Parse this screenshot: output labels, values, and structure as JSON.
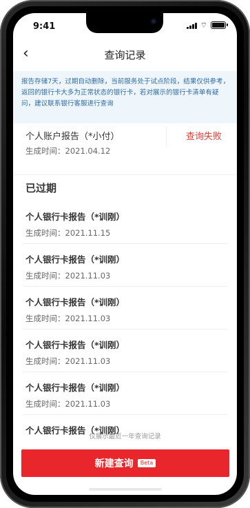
{
  "status_bar": {
    "time": "9:41"
  },
  "navbar": {
    "title": "查询记录",
    "back_icon": "chevron-left-icon"
  },
  "notice": {
    "text": "报告存储7天，过期自动删除，当前服务处于试点阶段，结果仅供参考，返回的银行卡大多为正常状态的银行卡，若对展示的银行卡清单有疑问，建议联系银行客服进行查询"
  },
  "current_record": {
    "title": "个人账户报告（*小付）",
    "time": "生成时间：2021.04.12",
    "status": "查询失败",
    "status_color": "#e53935"
  },
  "expired": {
    "header": "已过期",
    "items": [
      {
        "title": "个人银行卡报告（*训刚）",
        "time": "生成时间：2021.11.15"
      },
      {
        "title": "个人银行卡报告（*训刚）",
        "time": "生成时间：2021.11.03"
      },
      {
        "title": "个人银行卡报告（*训刚）",
        "time": "生成时间：2021.11.03"
      },
      {
        "title": "个人银行卡报告（*训刚）",
        "time": "生成时间：2021.11.03"
      },
      {
        "title": "个人银行卡报告（*训刚）",
        "time": "生成时间：2021.11.03"
      },
      {
        "title": "个人银行卡报告（*训刚）",
        "time": ""
      }
    ]
  },
  "footnote": "仅展示最近一年查询记录",
  "cta": {
    "label": "新建查询",
    "badge": "Beta",
    "color": "#e8262b"
  }
}
